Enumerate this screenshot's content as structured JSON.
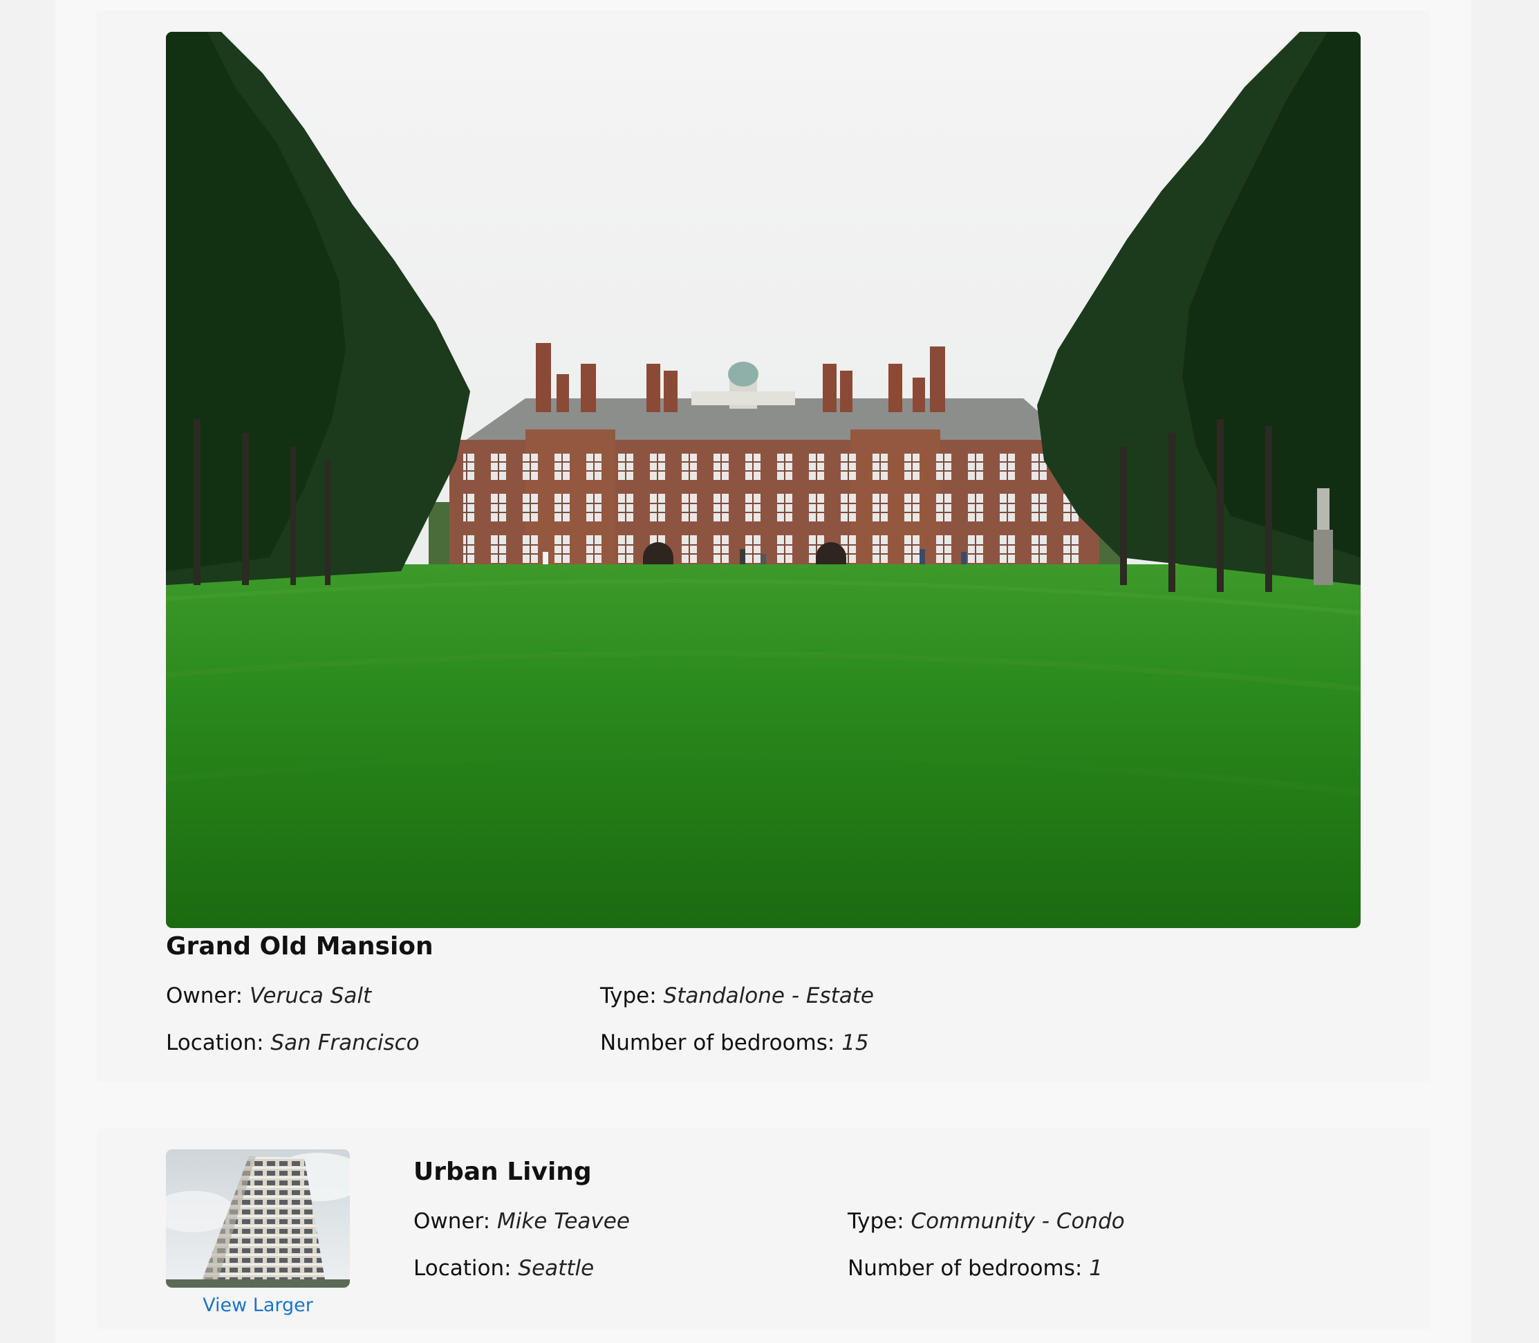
{
  "listings": [
    {
      "title": "Grand Old Mansion",
      "owner_label": "Owner:",
      "owner": "Veruca Salt",
      "type_label": "Type:",
      "type": "Standalone - Estate",
      "location_label": "Location:",
      "location": "San Francisco",
      "bedrooms_label": "Number of bedrooms:",
      "bedrooms": "15",
      "image_icon": "mansion-photo"
    },
    {
      "title": "Urban Living",
      "owner_label": "Owner:",
      "owner": "Mike Teavee",
      "type_label": "Type:",
      "type": "Community - Condo",
      "location_label": "Location:",
      "location": "Seattle",
      "bedrooms_label": "Number of bedrooms:",
      "bedrooms": "1",
      "image_icon": "condo-tower-photo",
      "view_larger_label": "View Larger"
    }
  ],
  "colors": {
    "page_bg": "#f2f2f2",
    "card_bg": "#f5f5f5",
    "link": "#1a75c8"
  }
}
